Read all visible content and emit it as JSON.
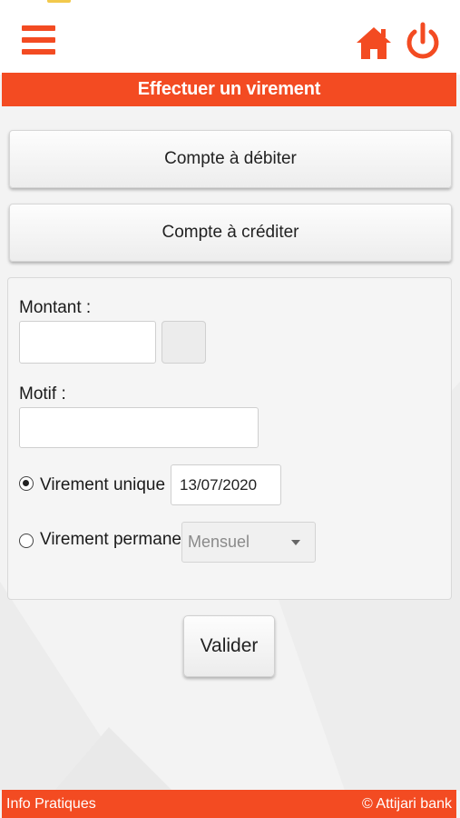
{
  "colors": {
    "accent": "#f34b22",
    "panel_bg": "#f5f5f5"
  },
  "header": {
    "menu_icon": "hamburger-menu-icon",
    "home_icon": "home-icon",
    "power_icon": "power-icon",
    "title": "Effectuer un virement"
  },
  "accounts": {
    "debit_label": "Compte à débiter",
    "credit_label": "Compte à créditer"
  },
  "form": {
    "amount_label": "Montant  :",
    "amount_value": "",
    "reason_label": "Motif :",
    "reason_value": "",
    "single_transfer_label": "Virement unique le",
    "single_transfer_selected": true,
    "date_value": "13/07/2020",
    "permanent_transfer_label": "Virement permanent",
    "frequency_value": "Mensuel",
    "submit_label": "Valider"
  },
  "footer": {
    "info_label": "Info Pratiques",
    "copyright": "© Attijari bank"
  }
}
